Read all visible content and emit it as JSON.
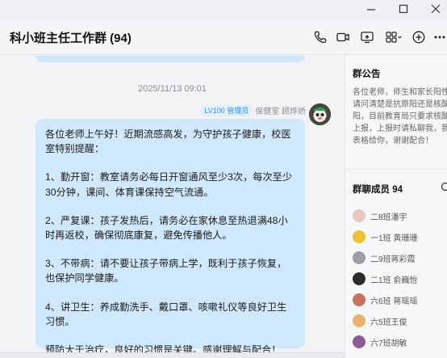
{
  "window": {
    "min_icon": "minimize-icon",
    "max_icon": "maximize-icon",
    "close_icon": "close-icon"
  },
  "header": {
    "title": "科小班主任工作群 (94)",
    "icons": [
      "phone-icon",
      "video-camera-icon",
      "screen-share-icon",
      "apps-grid-icon",
      "add-icon",
      "more-icon"
    ]
  },
  "chat": {
    "timestamp": "2025/11/13 09:01",
    "sender": {
      "badge": "LV100 管理员",
      "name": "保健室 顾烨娇"
    },
    "message_paragraphs": [
      "各位老师上午好！近期流感高发，为守护孩子健康，校医室特别提醒：",
      "1、勤开窗：教室请务必每日开窗通风至少3次，每次至少30分钟，课间、体育课保持空气流通。",
      "2、严复课：孩子发热后，请务必在家休息至热退满48小时再返校，确保彻底康复，避免传播他人。",
      "3、不带病：请不要让孩子带病上学，既利于孩子恢复，也保护同学健康。",
      "4、讲卫生：养成勤洗手、戴口罩、咳嗽礼仪等良好卫生习惯。",
      "预防大于治疗，良好的习惯是关键。感谢理解与配合！"
    ]
  },
  "sidebar": {
    "announcement_title": "群公告",
    "announcement_text": "各位老师，师生和家长阳性，请问清楚是抗原阳还是核酸阳，目前教育局只要求核酸阳上报，上报时请私聊我，我方表格给你，谢谢配合！",
    "members_title": "群聊成员 94",
    "members": [
      {
        "name": "二8班潘宇",
        "color": "#e7c9c4"
      },
      {
        "name": "一1班 黄珊珊",
        "color": "#f0c230"
      },
      {
        "name": "二9班蒋彩霞",
        "color": "#9aa0a6"
      },
      {
        "name": "二1班 俞巍怡",
        "color": "#2c2c2c"
      },
      {
        "name": "六6班 蒋瑶瑶",
        "color": "#c7735f"
      },
      {
        "name": "六5班王俊",
        "color": "#e8b36a"
      },
      {
        "name": "六7班胡敏",
        "color": "#8e5c9a"
      }
    ]
  },
  "colors": {
    "bubble": "#cfe8fb",
    "accent": "#3a8ef6",
    "background": "#f2f3f5"
  }
}
